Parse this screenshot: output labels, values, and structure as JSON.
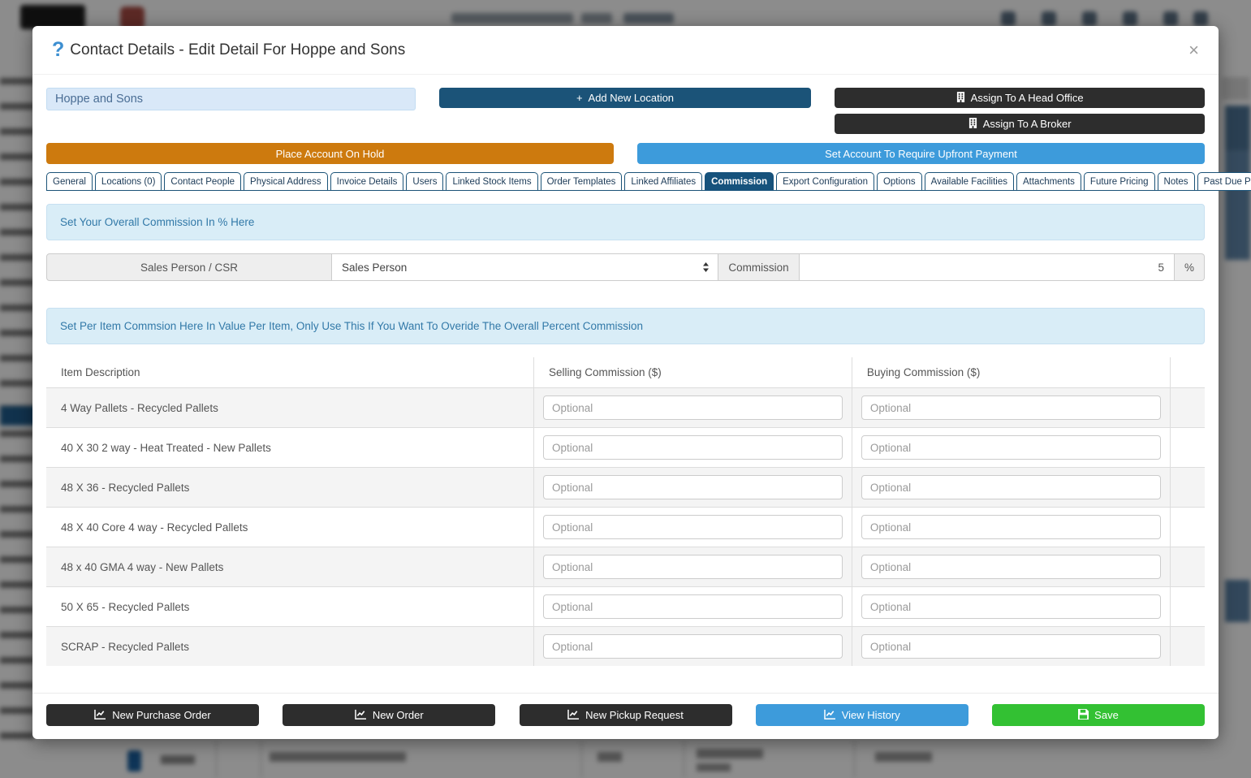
{
  "modal": {
    "title": "Contact Details - Edit Detail For Hoppe and Sons"
  },
  "icons": {
    "help": "?",
    "close": "×",
    "plus": "+"
  },
  "header_actions": {
    "account_name": "Hoppe and Sons",
    "add_location": "Add New Location",
    "assign_head_office": "Assign To A Head Office",
    "assign_broker": "Assign To A Broker",
    "place_on_hold": "Place Account On Hold",
    "upfront_payment": "Set Account To Require Upfront Payment"
  },
  "tabs": [
    {
      "label": "General"
    },
    {
      "label": "Locations (0)"
    },
    {
      "label": "Contact People"
    },
    {
      "label": "Physical Address"
    },
    {
      "label": "Invoice Details"
    },
    {
      "label": "Users"
    },
    {
      "label": "Linked Stock Items"
    },
    {
      "label": "Order Templates"
    },
    {
      "label": "Linked Affiliates"
    },
    {
      "label": "Commission",
      "active": true
    },
    {
      "label": "Export Configuration"
    },
    {
      "label": "Options"
    },
    {
      "label": "Available Facilities"
    },
    {
      "label": "Attachments"
    },
    {
      "label": "Future Pricing"
    },
    {
      "label": "Notes"
    },
    {
      "label": "Past Due Payments"
    }
  ],
  "commission": {
    "info_overall": "Set Your Overall Commission In % Here",
    "sales_person_label": "Sales Person / CSR",
    "sales_person_value": "Sales Person",
    "commission_label": "Commission",
    "commission_value": "5",
    "unit": "%",
    "info_per_item": "Set Per Item Commsion Here In Value Per Item, Only Use This If You Want To Overide The Overall Percent Commission"
  },
  "table": {
    "headers": [
      "Item Description",
      "Selling Commission ($)",
      "Buying Commission ($)"
    ],
    "placeholder": "Optional",
    "rows": [
      {
        "item": "4 Way Pallets - Recycled Pallets"
      },
      {
        "item": "40 X 30 2 way - Heat Treated - New Pallets"
      },
      {
        "item": "48 X 36 - Recycled Pallets"
      },
      {
        "item": "48 X 40 Core 4 way - Recycled Pallets"
      },
      {
        "item": "48 x 40 GMA 4 way - New Pallets"
      },
      {
        "item": "50 X 65 - Recycled Pallets"
      },
      {
        "item": "SCRAP - Recycled Pallets"
      }
    ]
  },
  "footer": {
    "new_purchase_order": "New Purchase Order",
    "new_order": "New Order",
    "new_pickup_request": "New Pickup Request",
    "view_history": "View History",
    "save": "Save"
  },
  "colors": {
    "dark_blue": "#1b5378",
    "tab_active": "#16527c",
    "orange": "#cd7a0e",
    "light_blue": "#3d9bdb",
    "green": "#33c133",
    "dark": "#2d2d2d",
    "info_bg": "#d9edf7",
    "info_text": "#3279a8"
  }
}
